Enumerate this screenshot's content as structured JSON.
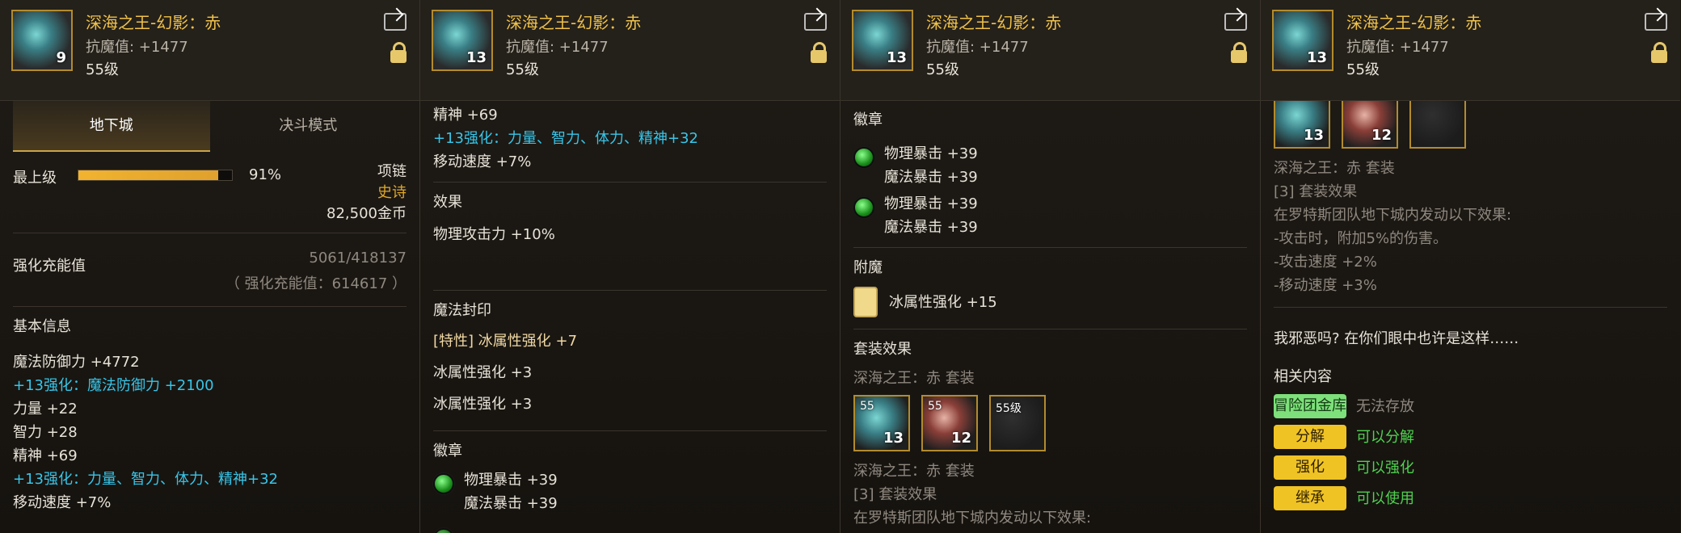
{
  "header": {
    "title": "深海之王-幻影：赤",
    "stat": "抗魔值: +1477",
    "level": "55级",
    "thumb_counts": [
      "9",
      "13",
      "13",
      "13"
    ]
  },
  "panel1": {
    "tabs": [
      "地下城",
      "决斗模式"
    ],
    "top_level_label": "最上级",
    "percent": "91%",
    "percent_value": 0.91,
    "item_slot": "项链",
    "rarity": "史诗",
    "price": "82,500金币",
    "strength_label": "强化充能值",
    "strength_value": "5061/418137",
    "strength_total": "（ 强化充能值：614617 ）",
    "basic_title": "基本信息",
    "basic_lines": [
      {
        "text": "魔法防御力 +4772",
        "type": "white"
      },
      {
        "text": "+13强化：魔法防御力 +2100",
        "type": "blue"
      },
      {
        "text": "力量 +22",
        "type": "white"
      },
      {
        "text": "智力 +28",
        "type": "white"
      },
      {
        "text": "精神 +69",
        "type": "white"
      },
      {
        "text": "+13强化：力量、智力、体力、精神+32",
        "type": "blue"
      },
      {
        "text": "移动速度 +7%",
        "type": "white"
      }
    ]
  },
  "panel2": {
    "top_lines": [
      {
        "text": "精神 +69",
        "type": "white"
      },
      {
        "text": "+13强化：力量、智力、体力、精神+32",
        "type": "blue"
      },
      {
        "text": "移动速度 +7%",
        "type": "white"
      }
    ],
    "effect_title": "效果",
    "effect_lines": [
      "物理攻击力 +10%"
    ],
    "magic_title": "魔法封印",
    "magic_lines": [
      {
        "text": "[特性] 冰属性强化 +7",
        "type": "lightgold"
      },
      {
        "text": "冰属性强化 +3",
        "type": "white"
      },
      {
        "text": "冰属性强化 +3",
        "type": "white"
      }
    ],
    "badge_title": "徽章",
    "badge_group": [
      {
        "lines": [
          "物理暴击 +39",
          "魔法暴击 +39"
        ]
      }
    ]
  },
  "panel3": {
    "badge_title": "徽章",
    "badge_groups": [
      {
        "lines": [
          "物理暴击 +39",
          "魔法暴击 +39"
        ]
      },
      {
        "lines": [
          "物理暴击 +39",
          "魔法暴击 +39"
        ]
      }
    ],
    "enchant_title": "附魔",
    "enchant_text": "冰属性强化 +15",
    "set_title": "套装效果",
    "set_name": "深海之王：赤 套装",
    "set_tiles": [
      {
        "num": "13",
        "tag": "55"
      },
      {
        "num": "12",
        "tag": "55"
      },
      {
        "num": "",
        "tag": "55级"
      }
    ],
    "set_name_2": "深海之王：赤 套装",
    "set_desc_lines": [
      "[3] 套装效果",
      "在罗特斯团队地下城内发动以下效果:"
    ]
  },
  "panel4": {
    "top_tiles": [
      {
        "num": "13"
      },
      {
        "num": "12"
      },
      {
        "num": ""
      }
    ],
    "set_name": "深海之王：赤 套装",
    "set_lines": [
      {
        "text": "[3] 套装效果",
        "type": "muted"
      },
      {
        "text": "在罗特斯团队地下城内发动以下效果:",
        "type": "muted"
      },
      {
        "text": "-攻击时，附加5%的伤害。",
        "type": "muted"
      },
      {
        "text": "-攻击速度 +2%",
        "type": "muted"
      },
      {
        "text": "-移动速度 +3%",
        "type": "muted"
      }
    ],
    "quote": "我邪恶吗? 在你们眼中也许是这样……",
    "related_title": "相关内容",
    "related_items": [
      {
        "btn": "冒险团金库",
        "btn_type": "green",
        "desc": "无法存放",
        "desc_type": "muted"
      },
      {
        "btn": "分解",
        "btn_type": "yellow",
        "desc": "可以分解",
        "desc_type": "green"
      },
      {
        "btn": "强化",
        "btn_type": "yellow",
        "desc": "可以强化",
        "desc_type": "green"
      },
      {
        "btn": "继承",
        "btn_type": "yellow",
        "desc": "可以使用",
        "desc_type": "green"
      }
    ]
  }
}
